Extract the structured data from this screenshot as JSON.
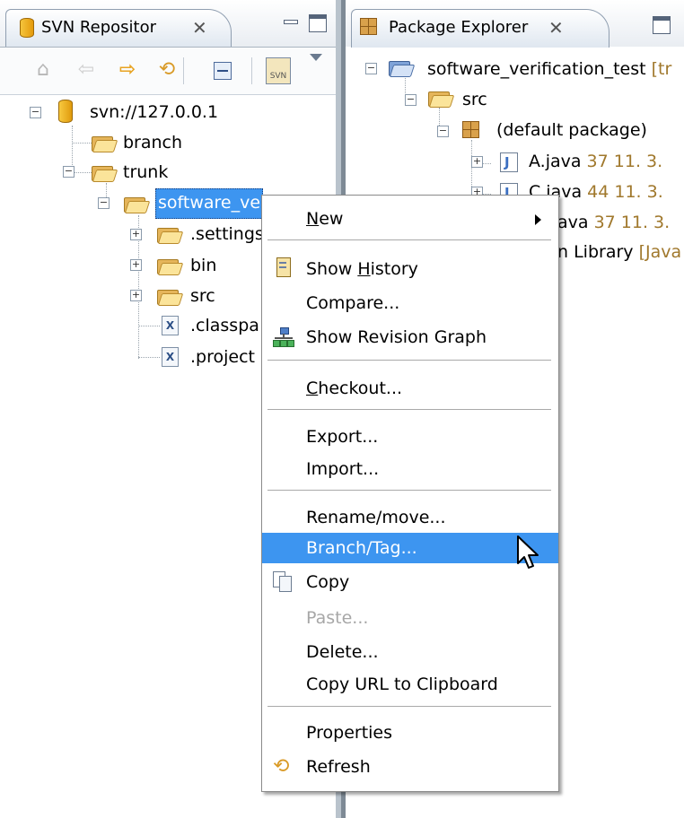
{
  "left_view": {
    "title": "SVN Repositor",
    "close_glyph": "✕",
    "toolbar_icons": [
      "home-icon",
      "back-arrow-icon",
      "forward-arrow-icon",
      "refresh-icon",
      "collapse-all-icon",
      "svn-import-icon",
      "view-menu-icon"
    ],
    "tree": {
      "repo": "svn://127.0.0.1",
      "branch": "branch",
      "trunk": "trunk",
      "project": "software_ve",
      "children": [
        ".settings",
        "bin",
        "src",
        ".classpa",
        ".project"
      ]
    }
  },
  "right_view": {
    "title": "Package Explorer",
    "project": "software_verification_test",
    "project_suffix": " [tr",
    "src": "src",
    "default_package": "(default package)",
    "files": [
      {
        "name": "A.java",
        "rev": " 37  11. 3."
      },
      {
        "name": "C.java",
        "rev": " 44  11. 3."
      },
      {
        "name": "ava",
        "rev": " 37  11. 3."
      }
    ],
    "library": "n Library",
    "library_suffix": " [Java"
  },
  "context_menu": {
    "items": {
      "new": {
        "pre": "",
        "u": "N",
        "post": "ew"
      },
      "show_history": {
        "pre": "Show ",
        "u": "H",
        "post": "istory"
      },
      "compare": "Compare...",
      "show_revision_graph": "Show Revision Graph",
      "checkout": {
        "pre": "",
        "u": "C",
        "post": "heckout..."
      },
      "export": "Export...",
      "import": "Import...",
      "rename_move": "Rename/move...",
      "branch_tag": "Branch/Tag...",
      "copy": "Copy",
      "paste": "Paste...",
      "delete": "Delete...",
      "copy_url": "Copy URL to Clipboard",
      "properties": "Properties",
      "refresh": "Refresh"
    },
    "highlighted": "branch_tag",
    "highlight_color": "#3d95f0"
  }
}
